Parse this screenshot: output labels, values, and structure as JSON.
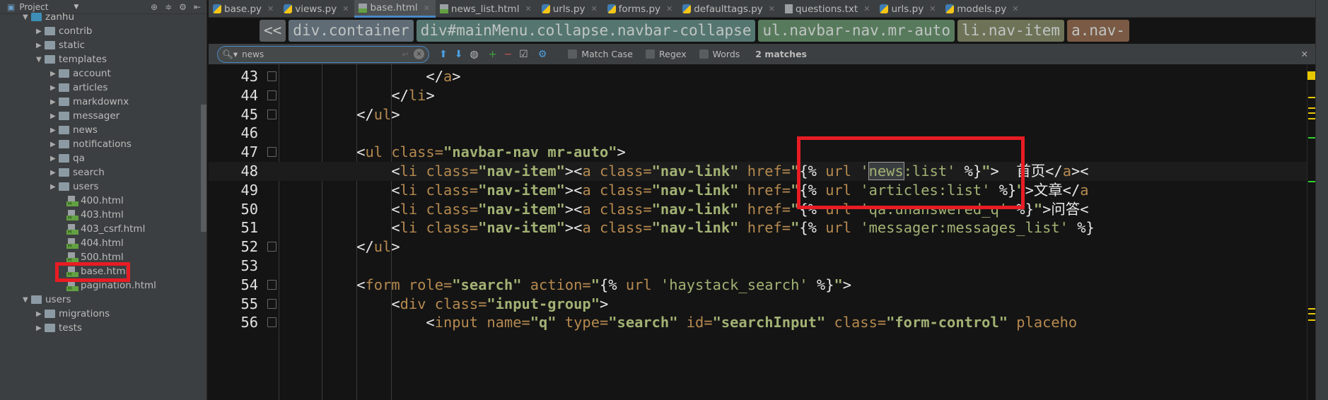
{
  "sidebar": {
    "title": "Project",
    "items": [
      {
        "label": "zanhu",
        "type": "folder-open",
        "level": 0
      },
      {
        "label": "contrib",
        "type": "folder",
        "level": 1
      },
      {
        "label": "static",
        "type": "folder",
        "level": 1
      },
      {
        "label": "templates",
        "type": "folder-open",
        "level": 1
      },
      {
        "label": "account",
        "type": "folder",
        "level": 2
      },
      {
        "label": "articles",
        "type": "folder",
        "level": 2
      },
      {
        "label": "markdownx",
        "type": "folder",
        "level": 2
      },
      {
        "label": "messager",
        "type": "folder",
        "level": 2
      },
      {
        "label": "news",
        "type": "folder",
        "level": 2
      },
      {
        "label": "notifications",
        "type": "folder",
        "level": 2
      },
      {
        "label": "qa",
        "type": "folder",
        "level": 2
      },
      {
        "label": "search",
        "type": "folder",
        "level": 2
      },
      {
        "label": "users",
        "type": "folder",
        "level": 2
      },
      {
        "label": "400.html",
        "type": "html",
        "level": 3
      },
      {
        "label": "403.html",
        "type": "html",
        "level": 3
      },
      {
        "label": "403_csrf.html",
        "type": "html",
        "level": 3
      },
      {
        "label": "404.html",
        "type": "html",
        "level": 3
      },
      {
        "label": "500.html",
        "type": "html",
        "level": 3
      },
      {
        "label": "base.html",
        "type": "html",
        "level": 3,
        "highlighted": true
      },
      {
        "label": "pagination.html",
        "type": "html",
        "level": 3
      },
      {
        "label": "users",
        "type": "folder-open",
        "level": 0
      },
      {
        "label": "migrations",
        "type": "folder",
        "level": 1
      },
      {
        "label": "tests",
        "type": "folder",
        "level": 1
      }
    ]
  },
  "tabs": [
    {
      "label": "base.py",
      "icon": "python"
    },
    {
      "label": "views.py",
      "icon": "python"
    },
    {
      "label": "base.html",
      "icon": "html",
      "active": true
    },
    {
      "label": "news_list.html",
      "icon": "html"
    },
    {
      "label": "urls.py",
      "icon": "python"
    },
    {
      "label": "forms.py",
      "icon": "python"
    },
    {
      "label": "defaulttags.py",
      "icon": "python"
    },
    {
      "label": "questions.txt",
      "icon": "text"
    },
    {
      "label": "urls.py",
      "icon": "python"
    },
    {
      "label": "models.py",
      "icon": "python"
    }
  ],
  "breadcrumb": {
    "back": "<<",
    "items": [
      {
        "label": "div.container",
        "color": "#5f6b75"
      },
      {
        "label": "div#mainMenu.collapse.navbar-collapse",
        "color": "#557670"
      },
      {
        "label": "ul.navbar-nav.mr-auto",
        "color": "#587a5c"
      },
      {
        "label": "li.nav-item",
        "color": "#6e7358"
      },
      {
        "label": "a.nav-",
        "color": "#7a5a44"
      }
    ]
  },
  "find": {
    "query": "news",
    "match_case": "Match Case",
    "regex": "Regex",
    "words": "Words",
    "matches": "2 matches"
  },
  "code": {
    "lines": [
      {
        "n": "43",
        "tok": [
          [
            "                ",
            "x"
          ],
          [
            "</",
            "p"
          ],
          [
            "a",
            "t"
          ],
          [
            ">",
            "p"
          ]
        ]
      },
      {
        "n": "44",
        "tok": [
          [
            "            ",
            "x"
          ],
          [
            "</",
            "p"
          ],
          [
            "li",
            "t"
          ],
          [
            ">",
            "p"
          ]
        ]
      },
      {
        "n": "45",
        "tok": [
          [
            "        ",
            "x"
          ],
          [
            "</",
            "p"
          ],
          [
            "ul",
            "t"
          ],
          [
            ">",
            "p"
          ]
        ]
      },
      {
        "n": "46",
        "tok": []
      },
      {
        "n": "47",
        "tok": [
          [
            "        ",
            "x"
          ],
          [
            "<",
            "p"
          ],
          [
            "ul class=",
            "t"
          ],
          [
            "\"navbar-nav mr-auto\"",
            "s"
          ],
          [
            ">",
            "p"
          ]
        ]
      },
      {
        "n": "48",
        "tok": [
          [
            "            ",
            "x"
          ],
          [
            "<",
            "p"
          ],
          [
            "li class=",
            "t"
          ],
          [
            "\"nav-item\"",
            "s"
          ],
          [
            "><",
            "p"
          ],
          [
            "a class=",
            "t"
          ],
          [
            "\"nav-link\"",
            "s"
          ],
          [
            " href=",
            "t"
          ],
          [
            "\"",
            "s"
          ],
          [
            "{%",
            "p"
          ],
          [
            " url ",
            "t"
          ],
          [
            "'",
            "g"
          ],
          [
            "news",
            "g"
          ],
          [
            ":list'",
            "g"
          ],
          [
            " %}",
            "p"
          ],
          [
            "\"",
            "s"
          ],
          [
            ">",
            "p"
          ],
          [
            "  首页</",
            "x"
          ],
          [
            "a",
            "t"
          ],
          [
            "><",
            "p"
          ]
        ],
        "current": true
      },
      {
        "n": "49",
        "tok": [
          [
            "            ",
            "x"
          ],
          [
            "<",
            "p"
          ],
          [
            "li class=",
            "t"
          ],
          [
            "\"nav-item\"",
            "s"
          ],
          [
            "><",
            "p"
          ],
          [
            "a class=",
            "t"
          ],
          [
            "\"nav-link\"",
            "s"
          ],
          [
            " href=",
            "t"
          ],
          [
            "\"",
            "s"
          ],
          [
            "{%",
            "p"
          ],
          [
            " url ",
            "t"
          ],
          [
            "'articles:list'",
            "g"
          ],
          [
            " %}",
            "p"
          ],
          [
            "\"",
            "s"
          ],
          [
            ">文章</",
            "x"
          ],
          [
            "a",
            "t"
          ]
        ]
      },
      {
        "n": "50",
        "tok": [
          [
            "            ",
            "x"
          ],
          [
            "<",
            "p"
          ],
          [
            "li class=",
            "t"
          ],
          [
            "\"nav-item\"",
            "s"
          ],
          [
            "><",
            "p"
          ],
          [
            "a class=",
            "t"
          ],
          [
            "\"nav-link\"",
            "s"
          ],
          [
            " href=",
            "t"
          ],
          [
            "\"",
            "s"
          ],
          [
            "{%",
            "p"
          ],
          [
            " url ",
            "t"
          ],
          [
            "'qa:unanswered_q'",
            "g"
          ],
          [
            " %}",
            "p"
          ],
          [
            "\"",
            "s"
          ],
          [
            ">问答<",
            "x"
          ]
        ]
      },
      {
        "n": "51",
        "tok": [
          [
            "            ",
            "x"
          ],
          [
            "<",
            "p"
          ],
          [
            "li class=",
            "t"
          ],
          [
            "\"nav-item\"",
            "s"
          ],
          [
            "><",
            "p"
          ],
          [
            "a class=",
            "t"
          ],
          [
            "\"nav-link\"",
            "s"
          ],
          [
            " href=",
            "t"
          ],
          [
            "\"",
            "s"
          ],
          [
            "{%",
            "p"
          ],
          [
            " url ",
            "t"
          ],
          [
            "'messager:messages_list'",
            "g"
          ],
          [
            " %}",
            "p"
          ]
        ]
      },
      {
        "n": "52",
        "tok": [
          [
            "        ",
            "x"
          ],
          [
            "</",
            "p"
          ],
          [
            "ul",
            "t"
          ],
          [
            ">",
            "p"
          ]
        ]
      },
      {
        "n": "53",
        "tok": []
      },
      {
        "n": "54",
        "tok": [
          [
            "        ",
            "x"
          ],
          [
            "<",
            "p"
          ],
          [
            "form role=",
            "t"
          ],
          [
            "\"search\"",
            "s"
          ],
          [
            " action=",
            "t"
          ],
          [
            "\"",
            "s"
          ],
          [
            "{%",
            "p"
          ],
          [
            " url ",
            "t"
          ],
          [
            "'haystack_search'",
            "g"
          ],
          [
            " %}",
            "p"
          ],
          [
            "\"",
            "s"
          ],
          [
            ">",
            "p"
          ]
        ]
      },
      {
        "n": "55",
        "tok": [
          [
            "            ",
            "x"
          ],
          [
            "<",
            "p"
          ],
          [
            "div class=",
            "t"
          ],
          [
            "\"input-group\"",
            "s"
          ],
          [
            ">",
            "p"
          ]
        ]
      },
      {
        "n": "56",
        "tok": [
          [
            "                ",
            "x"
          ],
          [
            "<",
            "p"
          ],
          [
            "input name=",
            "t"
          ],
          [
            "\"q\"",
            "s"
          ],
          [
            " type=",
            "t"
          ],
          [
            "\"search\"",
            "s"
          ],
          [
            " id=",
            "t"
          ],
          [
            "\"searchInput\"",
            "s"
          ],
          [
            " class=",
            "t"
          ],
          [
            "\"form-control\"",
            "s"
          ],
          [
            " placeho",
            "t"
          ]
        ]
      }
    ]
  }
}
